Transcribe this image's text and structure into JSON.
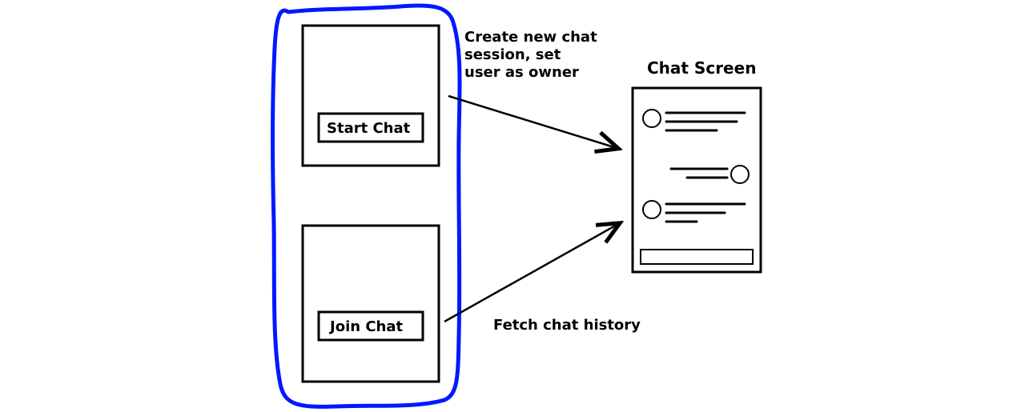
{
  "diagram": {
    "start_chat_button": "Start Chat",
    "join_chat_button": "Join Chat",
    "create_session_label_line1": "Create new chat",
    "create_session_label_line2": "session, set",
    "create_session_label_line3": "user as owner",
    "fetch_history_label": "Fetch chat history",
    "chat_screen_title": "Chat Screen"
  }
}
